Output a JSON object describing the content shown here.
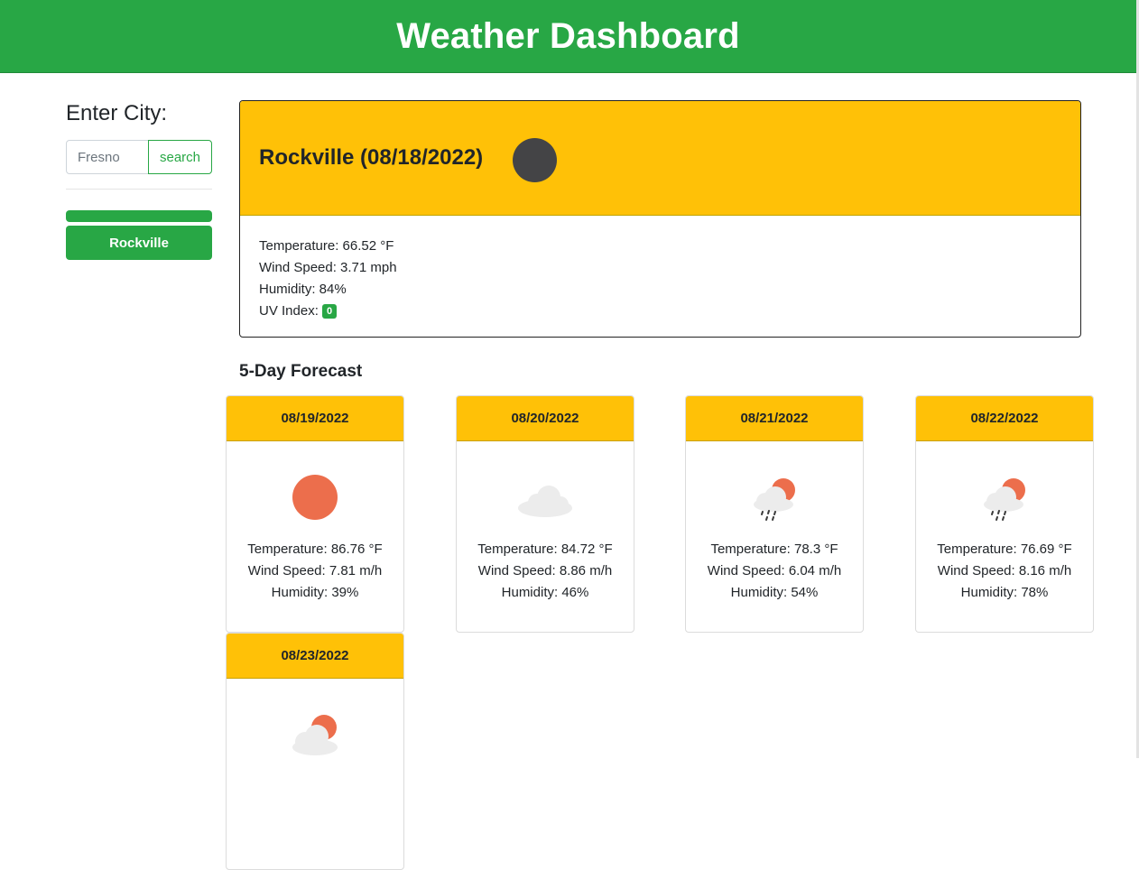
{
  "header": {
    "title": "Weather Dashboard"
  },
  "sidebar": {
    "label": "Enter City:",
    "search_placeholder": "Fresno",
    "search_button": "search",
    "history": [
      "",
      "Rockville"
    ]
  },
  "current": {
    "title": "Rockville (08/18/2022)",
    "icon": "moon-icon",
    "temperature": "Temperature: 66.52 °F",
    "wind": "Wind Speed: 3.71 mph",
    "humidity": "Humidity: 84%",
    "uv_label": "UV Index: ",
    "uv_value": "0",
    "uv_color": "#28a745"
  },
  "forecast_title": "5-Day Forecast",
  "forecast": [
    {
      "date": "08/19/2022",
      "icon": "sun-icon",
      "temperature": "Temperature: 86.76 °F",
      "wind": "Wind Speed: 7.81 m/h",
      "humidity": "Humidity: 39%"
    },
    {
      "date": "08/20/2022",
      "icon": "cloud-icon",
      "temperature": "Temperature: 84.72 °F",
      "wind": "Wind Speed: 8.86 m/h",
      "humidity": "Humidity: 46%"
    },
    {
      "date": "08/21/2022",
      "icon": "rain-sun-icon",
      "temperature": "Temperature: 78.3 °F",
      "wind": "Wind Speed: 6.04 m/h",
      "humidity": "Humidity: 54%"
    },
    {
      "date": "08/22/2022",
      "icon": "rain-sun-icon",
      "temperature": "Temperature: 76.69 °F",
      "wind": "Wind Speed: 8.16 m/h",
      "humidity": "Humidity: 78%"
    },
    {
      "date": "08/23/2022",
      "icon": "cloud-sun-icon",
      "temperature": "",
      "wind": "",
      "humidity": ""
    }
  ],
  "colors": {
    "primary": "#28a745",
    "accent": "#ffc107"
  }
}
